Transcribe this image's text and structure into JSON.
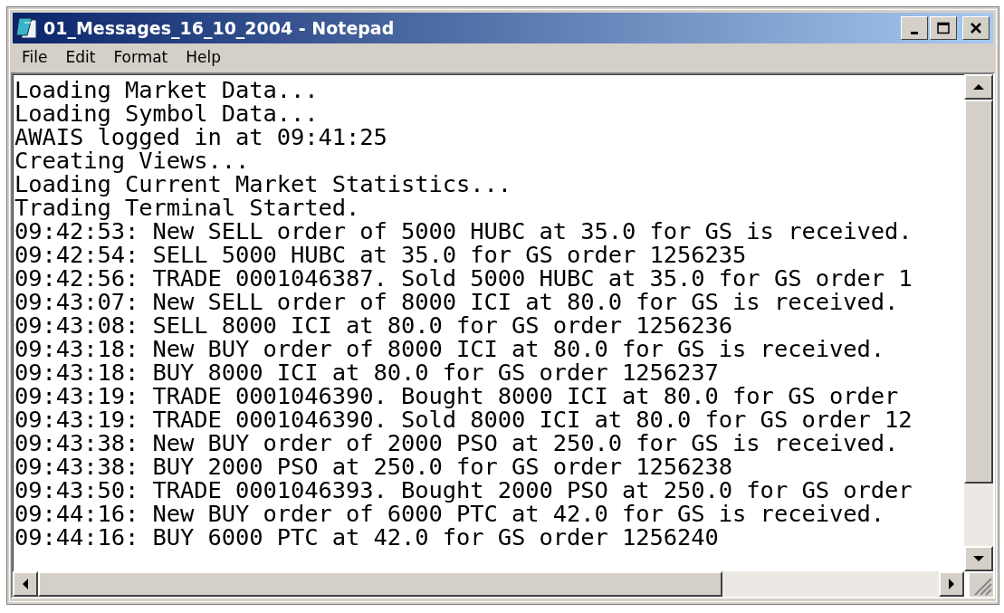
{
  "window": {
    "title": "01_Messages_16_10_2004 - Notepad"
  },
  "menu": [
    {
      "label": "File"
    },
    {
      "label": "Edit"
    },
    {
      "label": "Format"
    },
    {
      "label": "Help"
    }
  ],
  "editor": {
    "lines": [
      "Loading Market Data...",
      "Loading Symbol Data...",
      "AWAIS logged in at 09:41:25",
      "Creating Views...",
      "Loading Current Market Statistics...",
      "Trading Terminal Started.",
      "09:42:53: New SELL order of 5000 HUBC at 35.0 for GS is received.",
      "09:42:54: SELL 5000 HUBC at 35.0 for GS order 1256235",
      "09:42:56: TRADE 0001046387. Sold 5000 HUBC at 35.0 for GS order 1",
      "09:43:07: New SELL order of 8000 ICI at 80.0 for GS is received.",
      "09:43:08: SELL 8000 ICI at 80.0 for GS order 1256236",
      "09:43:18: New BUY order of 8000 ICI at 80.0 for GS is received.",
      "09:43:18: BUY 8000 ICI at 80.0 for GS order 1256237",
      "09:43:19: TRADE 0001046390. Bought 8000 ICI at 80.0 for GS order",
      "09:43:19: TRADE 0001046390. Sold 8000 ICI at 80.0 for GS order 12",
      "09:43:38: New BUY order of 2000 PSO at 250.0 for GS is received.",
      "09:43:38: BUY 2000 PSO at 250.0 for GS order 1256238",
      "09:43:50: TRADE 0001046393. Bought 2000 PSO at 250.0 for GS order",
      "09:44:16: New BUY order of 6000 PTC at 42.0 for GS is received.",
      "09:44:16: BUY 6000 PTC at 42.0 for GS order 1256240"
    ]
  }
}
